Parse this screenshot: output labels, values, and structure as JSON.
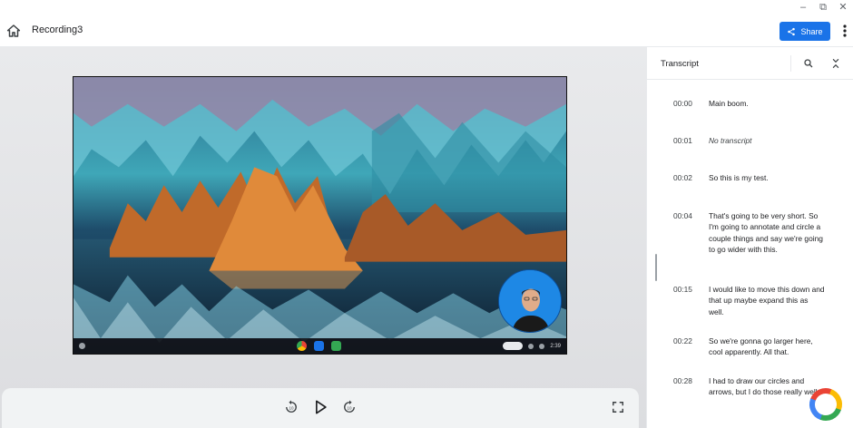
{
  "window": {
    "controls": [
      "–",
      "⧉",
      "✕"
    ]
  },
  "header": {
    "title": "Recording3",
    "share_label": "Share"
  },
  "transcript": {
    "title": "Transcript",
    "entries": [
      {
        "time": "00:00",
        "text": "Main boom."
      },
      {
        "time": "00:01",
        "text": "No transcript"
      },
      {
        "time": "00:02",
        "text": "So this is my test."
      },
      {
        "time": "00:04",
        "text": "That's going to be very short. So I'm going to annotate and circle a couple things and say we're going to go wider with this."
      },
      {
        "time": "00:15",
        "text": "I would like to move this down and that up maybe expand this as well."
      },
      {
        "time": "00:22",
        "text": "So we're gonna go larger here, cool apparently. All that."
      },
      {
        "time": "00:28",
        "text": "I had to draw our circles and arrows, but I do those really well."
      }
    ]
  },
  "video_taskbar": {
    "clock": "2:39"
  },
  "colors": {
    "accent": "#1a73e8",
    "panel_bg": "#ffffff",
    "player_bg": "#e9eaec"
  },
  "icons": [
    "home-icon",
    "share-icon",
    "more-vert-icon",
    "search-icon",
    "collapse-icon",
    "rewind-10-icon",
    "play-icon",
    "forward-10-icon",
    "fullscreen-icon",
    "google-logo-icon"
  ]
}
